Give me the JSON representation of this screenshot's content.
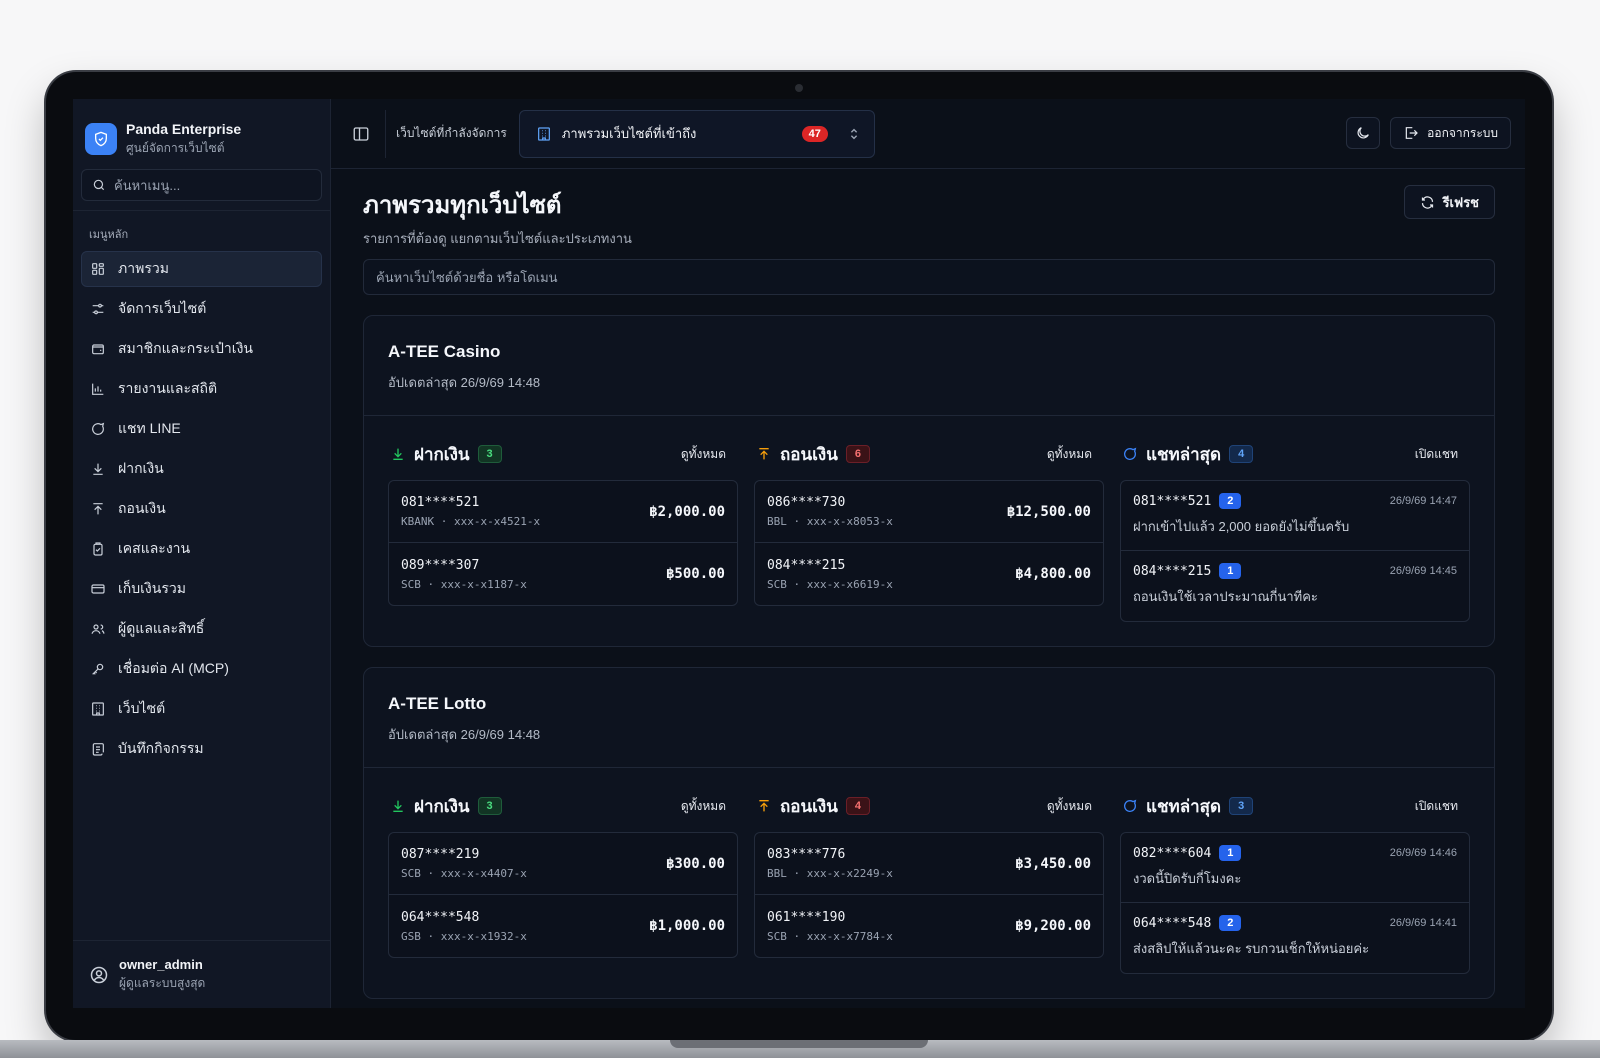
{
  "app": {
    "name": "Panda Enterprise",
    "subtitle": "ศูนย์จัดการเว็บไซต์"
  },
  "sidebar": {
    "search_placeholder": "ค้นหาเมนู...",
    "section_label": "เมนูหลัก",
    "items": [
      {
        "label": "ภาพรวม",
        "icon": "grid-icon",
        "active": true
      },
      {
        "label": "จัดการเว็บไซต์",
        "icon": "sliders-icon"
      },
      {
        "label": "สมาชิกและกระเป๋าเงิน",
        "icon": "wallet-icon"
      },
      {
        "label": "รายงานและสถิติ",
        "icon": "bar-chart-icon"
      },
      {
        "label": "แชท LINE",
        "icon": "chat-icon"
      },
      {
        "label": "ฝากเงิน",
        "icon": "arrow-down-icon"
      },
      {
        "label": "ถอนเงิน",
        "icon": "arrow-up-icon"
      },
      {
        "label": "เคสและงาน",
        "icon": "clipboard-icon"
      },
      {
        "label": "เก็บเงินรวม",
        "icon": "credit-card-icon"
      },
      {
        "label": "ผู้ดูแลและสิทธิ์",
        "icon": "users-icon"
      },
      {
        "label": "เชื่อมต่อ AI (MCP)",
        "icon": "key-icon"
      },
      {
        "label": "เว็บไซต์",
        "icon": "building-icon"
      },
      {
        "label": "บันทึกกิจกรรม",
        "icon": "scroll-icon"
      }
    ],
    "user": {
      "name": "owner_admin",
      "role": "ผู้ดูแลระบบสูงสุด"
    }
  },
  "topbar": {
    "managing_label": "เว็บไซต์ที่กำลังจัดการ",
    "selected_site": "ภาพรวมเว็บไซต์ที่เข้าถึง",
    "site_count": "47",
    "logout_label": "ออกจากระบบ"
  },
  "page": {
    "title": "ภาพรวมทุกเว็บไซต์",
    "subtitle": "รายการที่ต้องดู แยกตามเว็บไซต์และประเภทงาน",
    "refresh_label": "รีเฟรช",
    "search_placeholder": "ค้นหาเว็บไซต์ด้วยชื่อ หรือโดเมน"
  },
  "labels": {
    "deposit": "ฝากเงิน",
    "withdraw": "ถอนเงิน",
    "chat": "แชทล่าสุด",
    "view_all": "ดูทั้งหมด",
    "open_chat": "เปิดแชท"
  },
  "sites": [
    {
      "name": "A-TEE Casino",
      "updated": "อัปเดตล่าสุด 26/9/69 14:48",
      "deposit_count": "3",
      "withdraw_count": "6",
      "chat_count": "4",
      "deposits": [
        {
          "account": "081****521",
          "bank": "KBANK · xxx-x-x4521-x",
          "amount": "฿2,000.00"
        },
        {
          "account": "089****307",
          "bank": "SCB · xxx-x-x1187-x",
          "amount": "฿500.00"
        }
      ],
      "withdrawals": [
        {
          "account": "086****730",
          "bank": "BBL · xxx-x-x8053-x",
          "amount": "฿12,500.00"
        },
        {
          "account": "084****215",
          "bank": "SCB · xxx-x-x6619-x",
          "amount": "฿4,800.00"
        }
      ],
      "chats": [
        {
          "account": "081****521",
          "unread": "2",
          "time": "26/9/69 14:47",
          "message": "ฝากเข้าไปแล้ว 2,000 ยอดยังไม่ขึ้นครับ"
        },
        {
          "account": "084****215",
          "unread": "1",
          "time": "26/9/69 14:45",
          "message": "ถอนเงินใช้เวลาประมาณกี่นาทีคะ"
        }
      ]
    },
    {
      "name": "A-TEE Lotto",
      "updated": "อัปเดตล่าสุด 26/9/69 14:48",
      "deposit_count": "3",
      "withdraw_count": "4",
      "chat_count": "3",
      "deposits": [
        {
          "account": "087****219",
          "bank": "SCB · xxx-x-x4407-x",
          "amount": "฿300.00"
        },
        {
          "account": "064****548",
          "bank": "GSB · xxx-x-x1932-x",
          "amount": "฿1,000.00"
        }
      ],
      "withdrawals": [
        {
          "account": "083****776",
          "bank": "BBL · xxx-x-x2249-x",
          "amount": "฿3,450.00"
        },
        {
          "account": "061****190",
          "bank": "SCB · xxx-x-x7784-x",
          "amount": "฿9,200.00"
        }
      ],
      "chats": [
        {
          "account": "082****604",
          "unread": "1",
          "time": "26/9/69 14:46",
          "message": "งวดนี้ปิดรับกี่โมงคะ"
        },
        {
          "account": "064****548",
          "unread": "2",
          "time": "26/9/69 14:41",
          "message": "ส่งสลิปให้แล้วนะคะ รบกวนเช็กให้หน่อยค่ะ"
        }
      ]
    }
  ]
}
